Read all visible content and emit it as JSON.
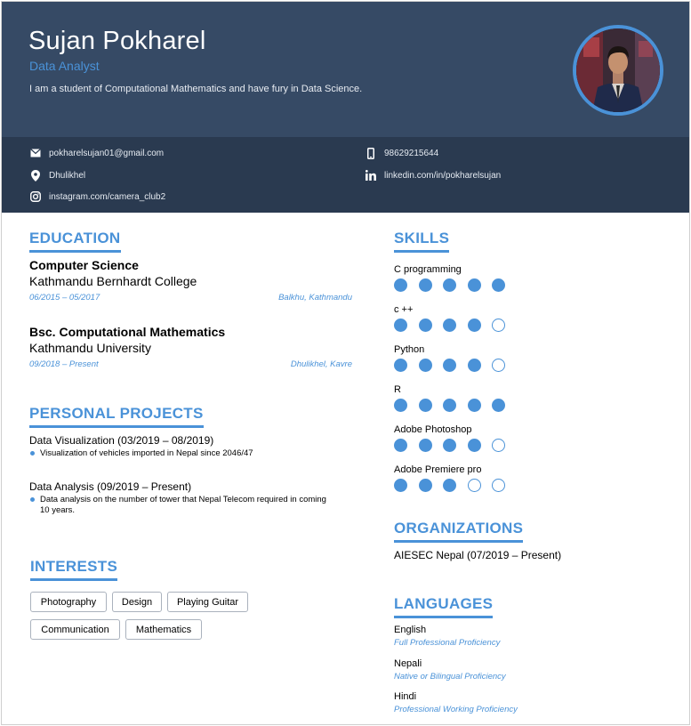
{
  "header": {
    "name": "Sujan Pokharel",
    "role": "Data Analyst",
    "bio": "I am a student of Computational Mathematics and have fury in Data Science."
  },
  "contact": {
    "email": "pokharelsujan01@gmail.com",
    "phone": "98629215644",
    "location": "Dhulikhel",
    "linkedin": "linkedin.com/in/pokharelsujan",
    "instagram": "instagram.com/camera_club2"
  },
  "colors": {
    "accent": "#4a92d8",
    "header_bg": "#364a65",
    "contact_bg": "#2a3a50"
  },
  "education": {
    "title": "EDUCATION",
    "items": [
      {
        "degree": "Computer Science",
        "school": "Kathmandu Bernhardt College",
        "dates": "06/2015 – 05/2017",
        "place": "Balkhu, Kathmandu"
      },
      {
        "degree": "Bsc. Computational Mathematics",
        "school": "Kathmandu University",
        "dates": "09/2018 – Present",
        "place": "Dhulikhel, Kavre"
      }
    ]
  },
  "projects": {
    "title": "PERSONAL PROJECTS",
    "items": [
      {
        "title": "Data Visualization (03/2019 – 08/2019)",
        "bullet": "Visualization of vehicles imported in Nepal since 2046/47"
      },
      {
        "title": "Data Analysis (09/2019 – Present)",
        "bullet": "Data analysis on the number of tower that Nepal Telecom required in coming 10 years."
      }
    ]
  },
  "interests": {
    "title": "INTERESTS",
    "tags": [
      "Photography",
      "Design",
      "Playing Guitar",
      "Communication",
      "Mathematics"
    ]
  },
  "skills": {
    "title": "SKILLS",
    "items": [
      {
        "name": "C programming",
        "level": 5,
        "max": 5
      },
      {
        "name": "c ++",
        "level": 4,
        "max": 5
      },
      {
        "name": "Python",
        "level": 4,
        "max": 5
      },
      {
        "name": "R",
        "level": 5,
        "max": 5
      },
      {
        "name": "Adobe Photoshop",
        "level": 4,
        "max": 5
      },
      {
        "name": "Adobe Premiere pro",
        "level": 3,
        "max": 5
      }
    ]
  },
  "organizations": {
    "title": "ORGANIZATIONS",
    "items": [
      "AIESEC Nepal (07/2019 – Present)"
    ]
  },
  "languages": {
    "title": "LANGUAGES",
    "items": [
      {
        "name": "English",
        "level": "Full Professional Proficiency"
      },
      {
        "name": "Nepali",
        "level": "Native or Bilingual Proficiency"
      },
      {
        "name": "Hindi",
        "level": "Professional Working Proficiency"
      }
    ]
  },
  "icons": [
    "email-icon",
    "phone-icon",
    "location-icon",
    "linkedin-icon",
    "instagram-icon"
  ]
}
